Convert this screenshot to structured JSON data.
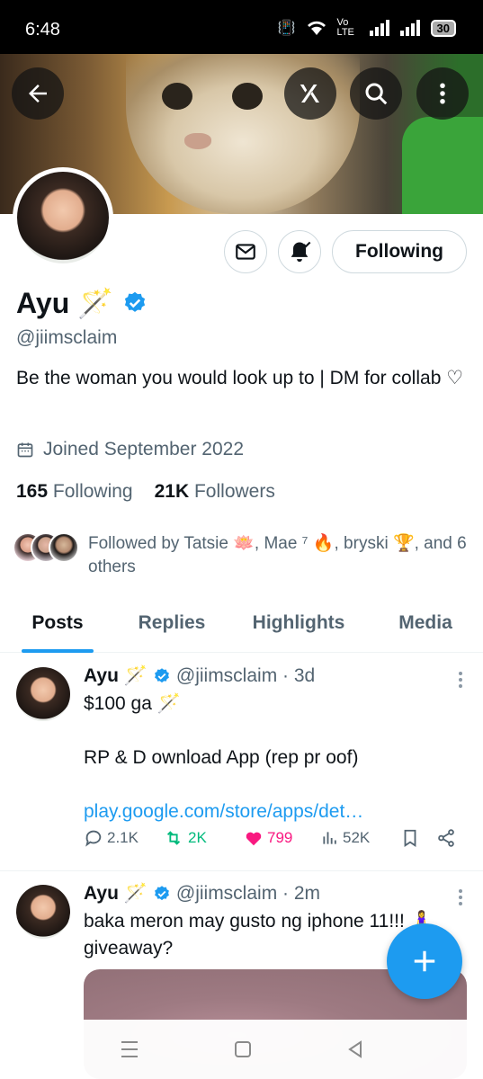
{
  "status_bar": {
    "time": "6:48",
    "network": "Vo LTE",
    "battery": "30"
  },
  "profile": {
    "name": "Ayu 🪄",
    "handle": "@jiimsclaim",
    "bio": "Be the woman you would look up to | DM for collab ♡",
    "joined": "Joined September 2022",
    "following_count": "165",
    "following_label": "Following",
    "followers_count": "21K",
    "followers_label": "Followers",
    "followed_by": "Followed by Tatsie 🪷, Mae ⁷ 🔥, bryski 🏆, and 6 others",
    "follow_button": "Following"
  },
  "tabs": [
    {
      "label": "Posts",
      "active": true
    },
    {
      "label": "Replies",
      "active": false
    },
    {
      "label": "Highlights",
      "active": false
    },
    {
      "label": "Media",
      "active": false
    }
  ],
  "posts": [
    {
      "name": "Ayu 🪄",
      "meta": "@jiimsclaim · 3d",
      "lines": [
        "$100 ga 🪄",
        "",
        "RP & D ownload App (rep pr oof)",
        ""
      ],
      "link": "play.google.com/store/apps/det…",
      "replies": "2.1K",
      "reposts": "2K",
      "likes": "799",
      "views": "52K"
    },
    {
      "name": "Ayu 🪄",
      "meta": "@jiimsclaim · 2m",
      "text": "baka meron may gusto ng iphone 11!!! 🧍‍♀️ giveaway?"
    }
  ],
  "icons": {
    "back": "arrow-left-icon",
    "grok": "grok-icon",
    "search": "search-icon",
    "more": "more-vertical-icon",
    "message": "envelope-icon",
    "notify": "bell-check-icon",
    "calendar": "calendar-icon",
    "verified": "verified-badge-icon",
    "compose": "plus-icon"
  },
  "colors": {
    "accent": "#1d9bf0",
    "like": "#f91880",
    "repost": "#00ba7c",
    "text": "#0f1419",
    "muted": "#536471"
  }
}
